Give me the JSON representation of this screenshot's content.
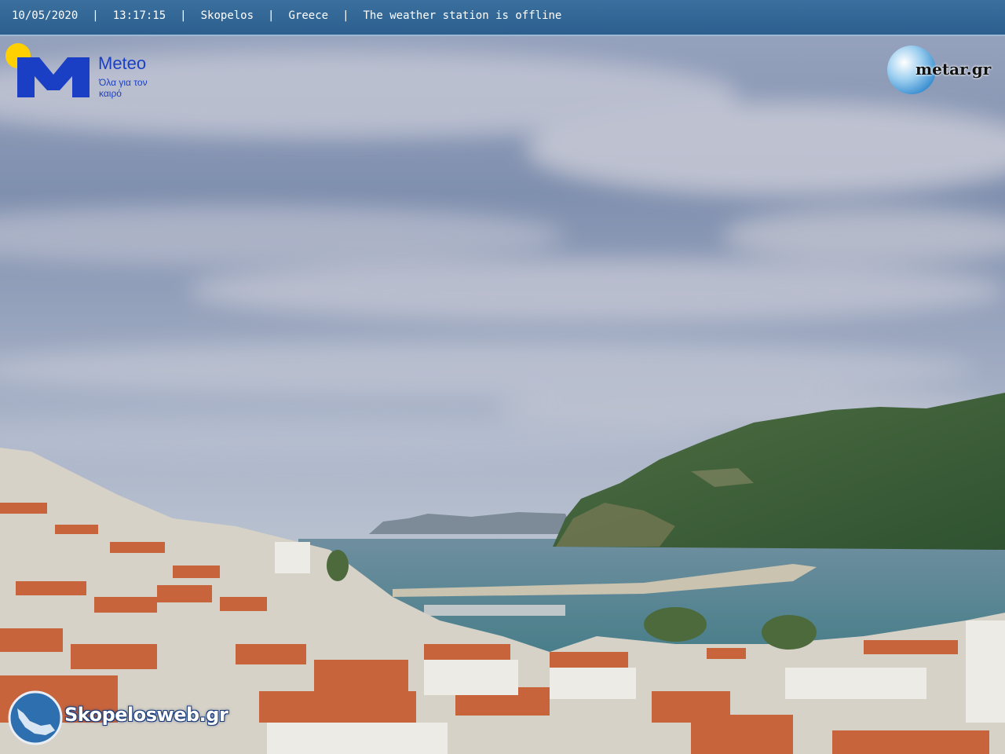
{
  "overlay": {
    "date": "10/05/2020",
    "separator": "|",
    "time": "13:17:15",
    "location": "Skopelos",
    "country": "Greece",
    "status": "The weather station is offline"
  },
  "logos": {
    "meteo_name": "Meteo",
    "meteo_tagline": "Όλα για τον καιρό",
    "metar_name": "metar.gr",
    "skopelos_name": "Skopelosweb.gr"
  },
  "colors": {
    "bar": "#2f6393",
    "sky": "#8e9cb6",
    "sea": "#4a7e86",
    "hill": "#3f6238",
    "roof": "#c8643c",
    "meteo_blue": "#1a3fc4",
    "meteo_sun": "#ffd000"
  }
}
